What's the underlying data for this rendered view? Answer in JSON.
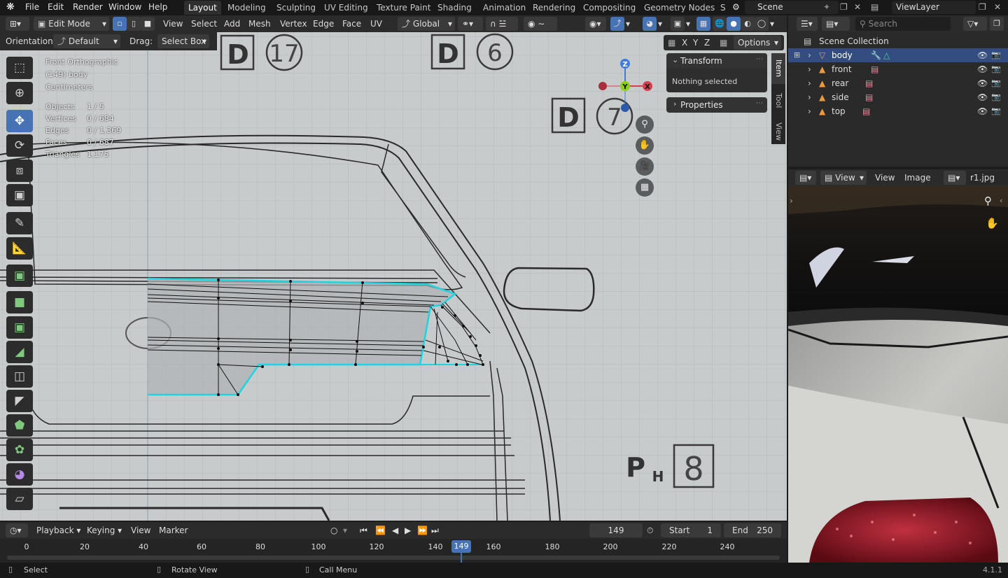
{
  "topbar": {
    "menus": [
      "File",
      "Edit",
      "Render",
      "Window",
      "Help"
    ],
    "workspaces": [
      "Layout",
      "Modeling",
      "Sculpting",
      "UV Editing",
      "Texture Paint",
      "Shading",
      "Animation",
      "Rendering",
      "Compositing",
      "Geometry Nodes",
      "S"
    ],
    "scene": "Scene",
    "view_layer": "ViewLayer"
  },
  "viewport_header": {
    "mode": "Edit Mode",
    "menus": [
      "View",
      "Select",
      "Add",
      "Mesh",
      "Vertex",
      "Edge",
      "Face",
      "UV"
    ],
    "transform_orientation": "Global"
  },
  "tool_header": {
    "orientation_label": "Orientation:",
    "orientation_value": "Default",
    "drag_label": "Drag:",
    "drag_value": "Select Box",
    "axes": [
      "X",
      "Y",
      "Z"
    ],
    "options": "Options"
  },
  "overlay": {
    "view_name": "Front Orthographic",
    "object": "(149) body",
    "units": "Centimeters",
    "stats": [
      {
        "label": "Objects",
        "value": "1 / 5"
      },
      {
        "label": "Vertices",
        "value": "0 / 684"
      },
      {
        "label": "Edges",
        "value": "0 / 1,369"
      },
      {
        "label": "Faces",
        "value": "0 / 687"
      },
      {
        "label": "Triangles",
        "value": "1,175"
      }
    ]
  },
  "gizmo": {
    "z": "Z",
    "y": "Y",
    "x": "X"
  },
  "blueprint_labels": {
    "d17_letter": "D",
    "d17_num": "17",
    "d6_letter": "D",
    "d6_num": "6",
    "d7_letter": "D",
    "d7_num": "7",
    "ph_letter": "P",
    "ph_sub": "H",
    "ph_num": "8"
  },
  "sidebar": {
    "transform_title": "Transform",
    "nothing_selected": "Nothing selected",
    "properties_title": "Properties",
    "tabs": [
      "Item",
      "Tool",
      "View"
    ]
  },
  "outliner": {
    "search_placeholder": "Search",
    "collection": "Scene Collection",
    "items": [
      {
        "name": "body",
        "selected": true
      },
      {
        "name": "front",
        "selected": false
      },
      {
        "name": "rear",
        "selected": false
      },
      {
        "name": "side",
        "selected": false
      },
      {
        "name": "top",
        "selected": false
      }
    ]
  },
  "image_editor": {
    "view_dropdown": "View",
    "menus": [
      "View",
      "Image"
    ],
    "image_name": "r1.jpg"
  },
  "timeline": {
    "menus": [
      "Playback",
      "Keying",
      "View",
      "Marker"
    ],
    "current_frame": "149",
    "start_label": "Start",
    "start_value": "1",
    "end_label": "End",
    "end_value": "250",
    "ticks": [
      "0",
      "20",
      "40",
      "60",
      "80",
      "100",
      "120",
      "140",
      "149",
      "160",
      "180",
      "200",
      "220",
      "240"
    ]
  },
  "statusbar": {
    "hints": [
      "Select",
      "Rotate View",
      "Call Menu"
    ],
    "version": "4.1.1"
  },
  "colors": {
    "accent": "#4772b3",
    "selection": "#334d80",
    "mesh_outline": "#1fd3e0",
    "x_axis": "#d9404f",
    "y_axis": "#8ccf1b",
    "z_axis": "#3d7de0"
  }
}
